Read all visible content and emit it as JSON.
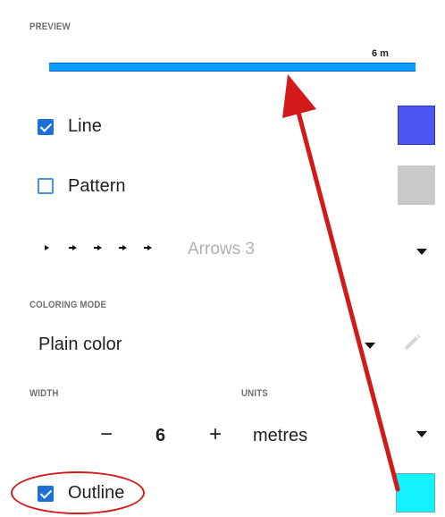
{
  "preview": {
    "section_label": "PREVIEW",
    "distance_label": "6 m",
    "line_color": "#0b9cf5"
  },
  "line": {
    "label": "Line",
    "checked": true,
    "swatch_color": "#3d5cf0"
  },
  "pattern": {
    "label": "Pattern",
    "checked": false,
    "swatch_color": "#c9c9c9"
  },
  "arrows": {
    "label": "Arrows 3",
    "icon": "arrow-markers-icon"
  },
  "coloring_mode": {
    "section_label": "COLORING MODE",
    "value": "Plain color",
    "edit_icon": "pencil-icon"
  },
  "width": {
    "section_label": "WIDTH",
    "decrement_label": "−",
    "value": "6",
    "increment_label": "+"
  },
  "units": {
    "section_label": "UNITS",
    "value": "metres"
  },
  "outline": {
    "label": "Outline",
    "checked": true,
    "swatch_color": "#13f3ff"
  },
  "annotation": {
    "color": "#d21a1a"
  }
}
